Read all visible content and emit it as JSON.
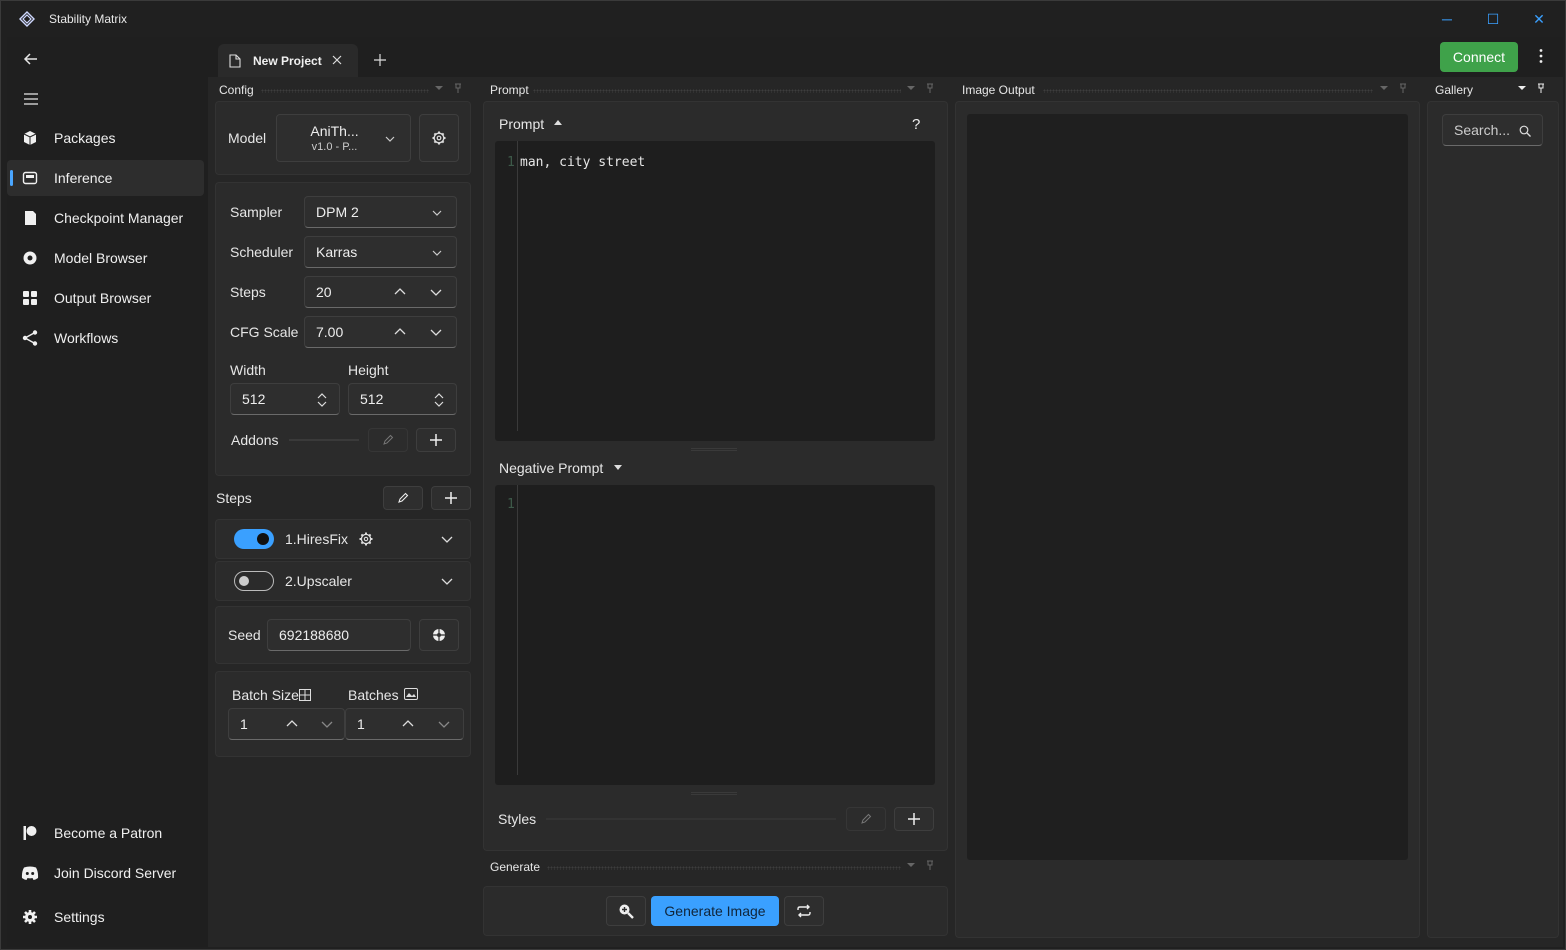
{
  "app": {
    "title": "Stability Matrix"
  },
  "window_controls": {
    "minimize": "─",
    "maximize": "☐",
    "close": "✕"
  },
  "sidebar": {
    "items": [
      {
        "label": "Packages",
        "icon": "package-icon"
      },
      {
        "label": "Inference",
        "icon": "inference-icon",
        "active": true
      },
      {
        "label": "Checkpoint Manager",
        "icon": "checkpoint-icon"
      },
      {
        "label": "Model Browser",
        "icon": "model-browser-icon"
      },
      {
        "label": "Output Browser",
        "icon": "grid-icon"
      },
      {
        "label": "Workflows",
        "icon": "workflow-icon"
      }
    ],
    "footer": [
      {
        "label": "Become a Patron",
        "icon": "patreon-icon"
      },
      {
        "label": "Join Discord Server",
        "icon": "discord-icon"
      },
      {
        "label": "Settings",
        "icon": "gear-icon"
      }
    ]
  },
  "tabs": [
    {
      "label": "New Project"
    }
  ],
  "header": {
    "connect_label": "Connect",
    "accent": "#3fa24a"
  },
  "config": {
    "header": "Config",
    "model_label": "Model",
    "model_name": "AniTh...",
    "model_version": "v1.0 - P...",
    "sampler_label": "Sampler",
    "sampler_value": "DPM 2",
    "scheduler_label": "Scheduler",
    "scheduler_value": "Karras",
    "steps_label": "Steps",
    "steps_value": "20",
    "cfg_label": "CFG Scale",
    "cfg_value": "7.00",
    "width_label": "Width",
    "width_value": "512",
    "height_label": "Height",
    "height_value": "512",
    "addons_label": "Addons"
  },
  "steps_section": {
    "label": "Steps",
    "items": [
      {
        "label": "1.HiresFix",
        "enabled": true
      },
      {
        "label": "2.Upscaler",
        "enabled": false
      }
    ]
  },
  "seed": {
    "label": "Seed",
    "value": "692188680"
  },
  "batch": {
    "size_label": "Batch Size",
    "size_value": "1",
    "batches_label": "Batches",
    "batches_value": "1"
  },
  "prompt": {
    "header": "Prompt",
    "title": "Prompt",
    "help": "?",
    "line_no": "1",
    "text": "man, city street",
    "negative_title": "Negative Prompt",
    "negative_line_no": "1",
    "negative_text": "",
    "styles_label": "Styles"
  },
  "generate": {
    "header": "Generate",
    "button_label": "Generate Image",
    "accent": "#3aa0ff"
  },
  "image_output": {
    "header": "Image Output"
  },
  "gallery": {
    "header": "Gallery",
    "search_placeholder": "Search..."
  }
}
